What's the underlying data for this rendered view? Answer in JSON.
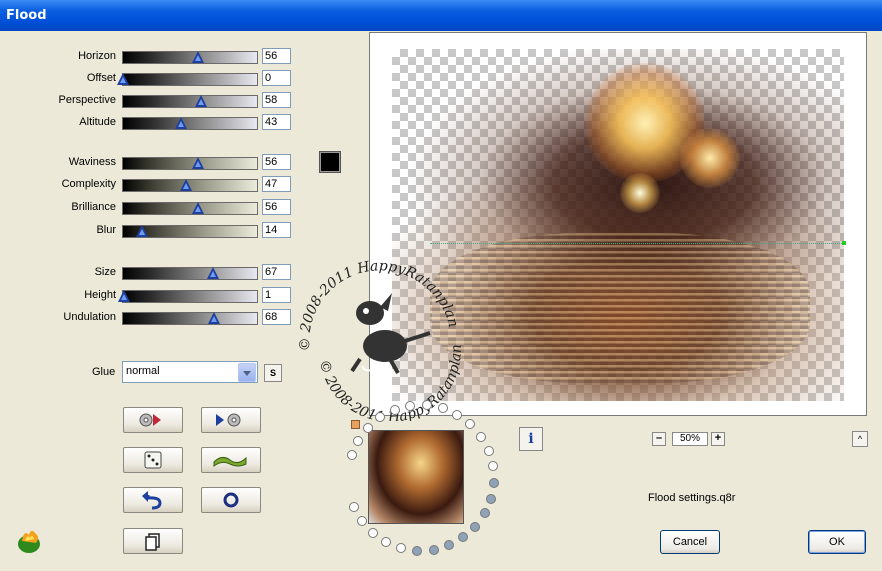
{
  "window": {
    "title": "Flood"
  },
  "sliders": [
    {
      "key": "horizon",
      "label": "Horizon",
      "value": "56",
      "fraction": 0.56,
      "track": "blk"
    },
    {
      "key": "offset",
      "label": "Offset",
      "value": "0",
      "fraction": 0.0,
      "track": "blk"
    },
    {
      "key": "perspective",
      "label": "Perspective",
      "value": "58",
      "fraction": 0.58,
      "track": "blk"
    },
    {
      "key": "altitude",
      "label": "Altitude",
      "value": "43",
      "fraction": 0.43,
      "track": "blk"
    },
    {
      "key": "waviness",
      "label": "Waviness",
      "value": "56",
      "fraction": 0.56,
      "track": "grn"
    },
    {
      "key": "complexity",
      "label": "Complexity",
      "value": "47",
      "fraction": 0.47,
      "track": "grn"
    },
    {
      "key": "brilliance",
      "label": "Brilliance",
      "value": "56",
      "fraction": 0.56,
      "track": "grn"
    },
    {
      "key": "blur",
      "label": "Blur",
      "value": "14",
      "fraction": 0.14,
      "track": "grn"
    },
    {
      "key": "size",
      "label": "Size",
      "value": "67",
      "fraction": 0.67,
      "track": "blk"
    },
    {
      "key": "height",
      "label": "Height",
      "value": "1",
      "fraction": 0.01,
      "track": "blk"
    },
    {
      "key": "undulation",
      "label": "Undulation",
      "value": "68",
      "fraction": 0.68,
      "track": "blk"
    }
  ],
  "color": {
    "swatch": "#000000"
  },
  "glue": {
    "label": "Glue",
    "value": "normal",
    "s_label": "S"
  },
  "zoom": {
    "value": "50%",
    "minus": "–",
    "plus": "+"
  },
  "info_label": "i",
  "up_label": "^",
  "settings_file": "Flood settings.q8r",
  "buttons": {
    "cancel": "Cancel",
    "ok": "OK"
  },
  "watermark": {
    "top": "© 2008-2011 HappyRatanplan",
    "bottom": "© 2008-2011 HappyRatanplan"
  }
}
